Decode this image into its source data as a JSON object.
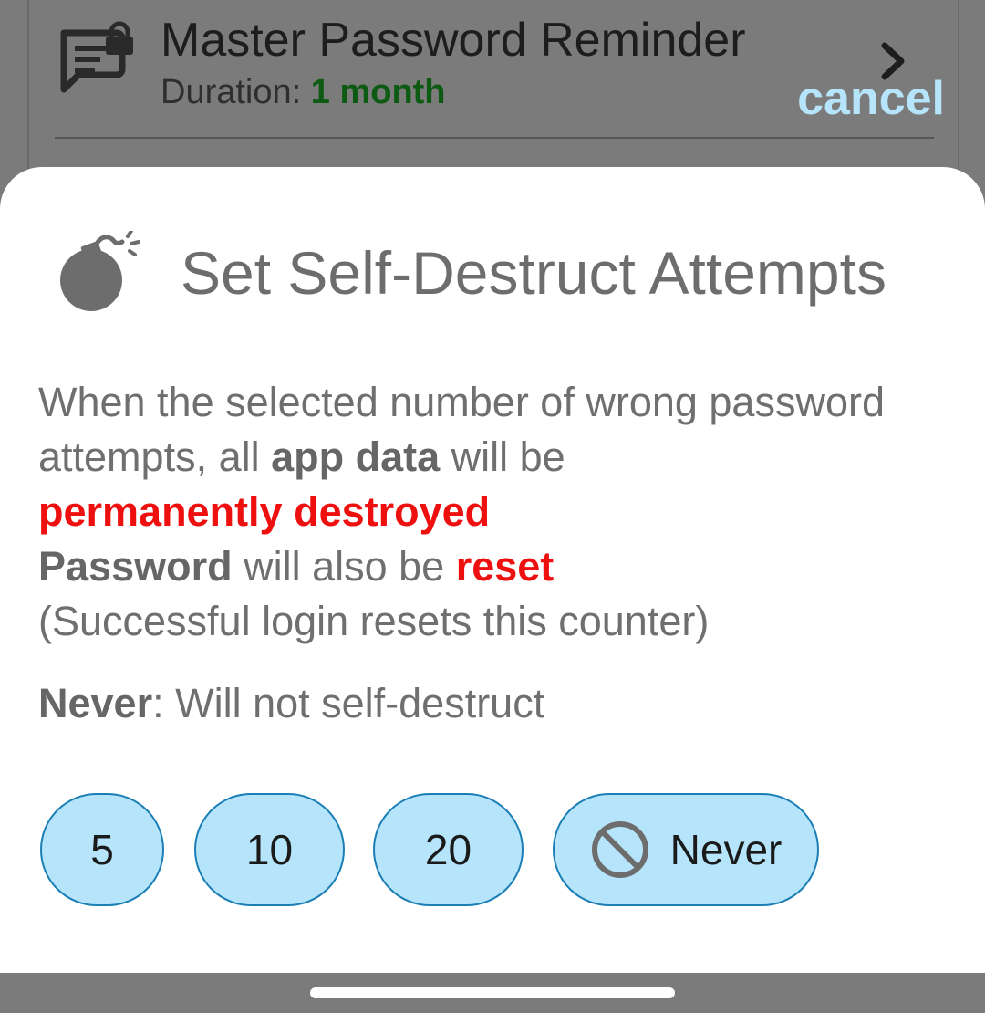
{
  "background_row": {
    "title": "Master Password Reminder",
    "duration_label": "Duration: ",
    "duration_value": "1 month",
    "cancel_label": "cancel",
    "icon": "chat-lock-icon",
    "chevron_icon": "chevron-right-icon"
  },
  "dialog": {
    "icon": "bomb-icon",
    "title": "Set Self-Destruct Attempts",
    "description": {
      "line1_a": "When the selected number of wrong password attempts, all ",
      "line1_strong": "app data",
      "line1_b": " will be",
      "line2_danger": "permanently destroyed",
      "line3_strong": "Password",
      "line3_a": " will also be ",
      "line3_danger": "reset",
      "line4": "(Successful login resets this counter)",
      "never_strong": "Never",
      "never_text": ": Will not self-destruct"
    },
    "options": [
      {
        "label": "5"
      },
      {
        "label": "10"
      },
      {
        "label": "20"
      },
      {
        "label": "Never",
        "icon": "no-symbol-icon"
      }
    ]
  },
  "colors": {
    "scrim": "#7b7b7b",
    "accent_fill": "#b6e5fb",
    "accent_border": "#1b7fb6",
    "danger": "#ee0f0f",
    "duration_green": "#0d5a12"
  }
}
